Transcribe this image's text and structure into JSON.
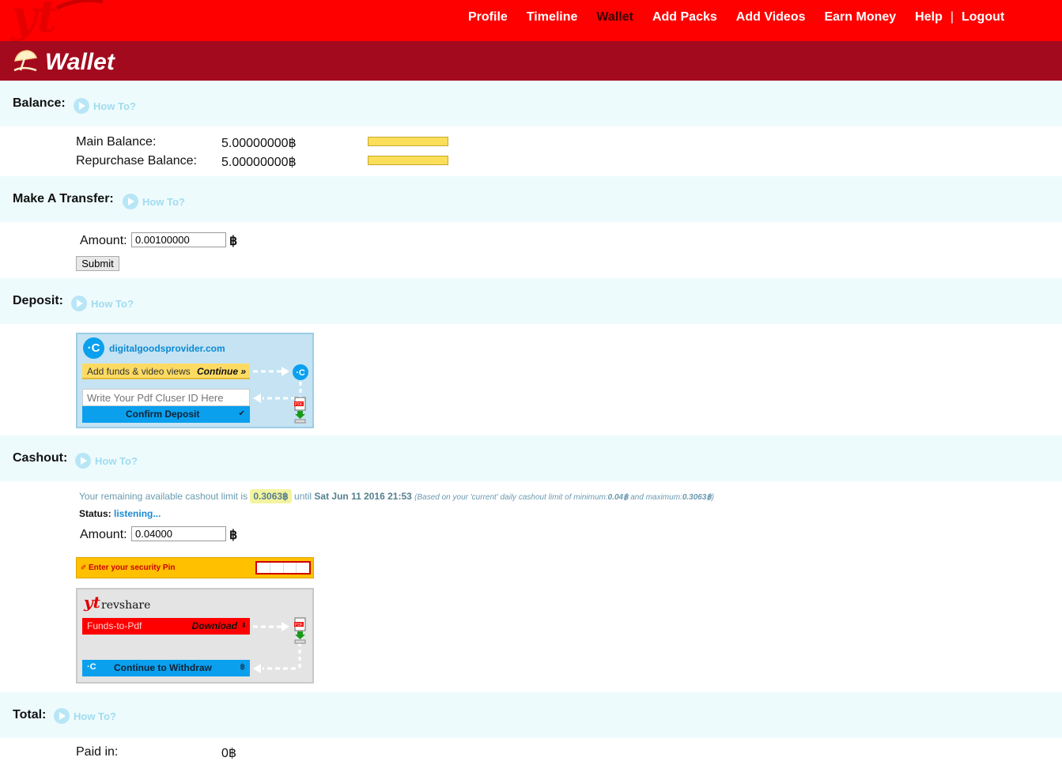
{
  "nav": {
    "items": [
      "Profile",
      "Timeline",
      "Wallet",
      "Add Packs",
      "Add Videos",
      "Earn Money",
      "Help"
    ],
    "separator": "|",
    "logout": "Logout",
    "active": "Wallet"
  },
  "page": {
    "title": "Wallet",
    "icon": "beach-umbrella-icon"
  },
  "howto_label": "How To?",
  "balance": {
    "label": "Balance:",
    "main_label": "Main Balance:",
    "main_value": "5.00000000฿",
    "repurchase_label": "Repurchase Balance:",
    "repurchase_value": "5.00000000฿"
  },
  "transfer": {
    "label": "Make A Transfer:",
    "amount_label": "Amount:",
    "amount_value": "0.00100000",
    "currency": "฿",
    "submit": "Submit"
  },
  "deposit": {
    "label": "Deposit:",
    "provider": "digitalgoodsprovider.com",
    "add_funds": "Add funds & video views",
    "continue": "Continue »",
    "id_placeholder": "Write Your Pdf Cluser ID Here",
    "confirm": "Confirm Deposit",
    "confirm_mark": "✔"
  },
  "cashout": {
    "label": "Cashout:",
    "limit_prefix": "Your remaining available cashout limit is",
    "limit_value": "0.3063฿",
    "until": "until",
    "until_date": "Sat Jun 11 2016 21:53",
    "note_prefix": "(Based on your 'current' daily cashout limit of minimum:",
    "note_min": "0.04฿",
    "note_mid": " and maximum:",
    "note_max": "0.3063฿",
    "note_suffix": ")",
    "status_label": "Status:",
    "status_value": "listening...",
    "amount_label": "Amount:",
    "amount_value": "0.04000",
    "currency": "฿",
    "pin_label": "Enter your security Pin",
    "brand": "revshare",
    "funds_to_pdf": "Funds-to-Pdf",
    "download": "Download",
    "download_icon": "⬇",
    "withdraw": "Continue to Withdraw",
    "withdraw_currency": "฿"
  },
  "total": {
    "label": "Total:",
    "paid_in_label": "Paid in:",
    "paid_in_value": "0฿"
  },
  "colors": {
    "topbar": "#ff0000",
    "titlebar": "#a30a1e",
    "section": "#eefbfd",
    "howto": "#9fdcf0",
    "bar": "#fbde5a",
    "deposit_blue": "#0aa0ee",
    "pin_bar": "#ffc000"
  }
}
